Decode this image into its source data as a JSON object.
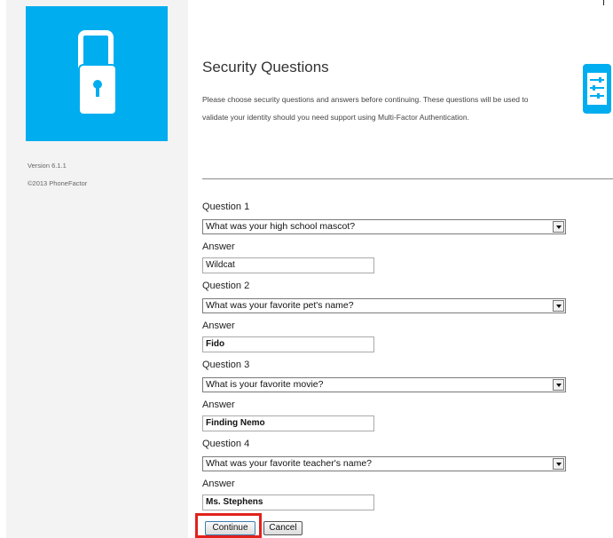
{
  "sidebar": {
    "version": "Version 6.1.1",
    "copyright": "©2013 PhoneFactor",
    "logo_icon": "phone-lock-icon",
    "logo_color": "#00adef"
  },
  "header": {
    "title": "Security Questions",
    "intro": "Please choose security questions and answers before continuing. These questions will be used to validate your identity should you need support using Multi-Factor Authentication.",
    "side_icon": "settings-sliders-icon"
  },
  "form": {
    "answer_label": "Answer",
    "questions": [
      {
        "label": "Question 1",
        "selected": "What was your high school mascot?",
        "answer": "Wildcat"
      },
      {
        "label": "Question 2",
        "selected": "What was your favorite pet's name?",
        "answer": "Fido"
      },
      {
        "label": "Question 3",
        "selected": "What is your favorite movie?",
        "answer": "Finding Nemo"
      },
      {
        "label": "Question 4",
        "selected": "What was your favorite teacher's name?",
        "answer": "Ms. Stephens"
      }
    ]
  },
  "actions": {
    "continue_label": "Continue",
    "cancel_label": "Cancel",
    "highlight_color": "#e2211c"
  }
}
